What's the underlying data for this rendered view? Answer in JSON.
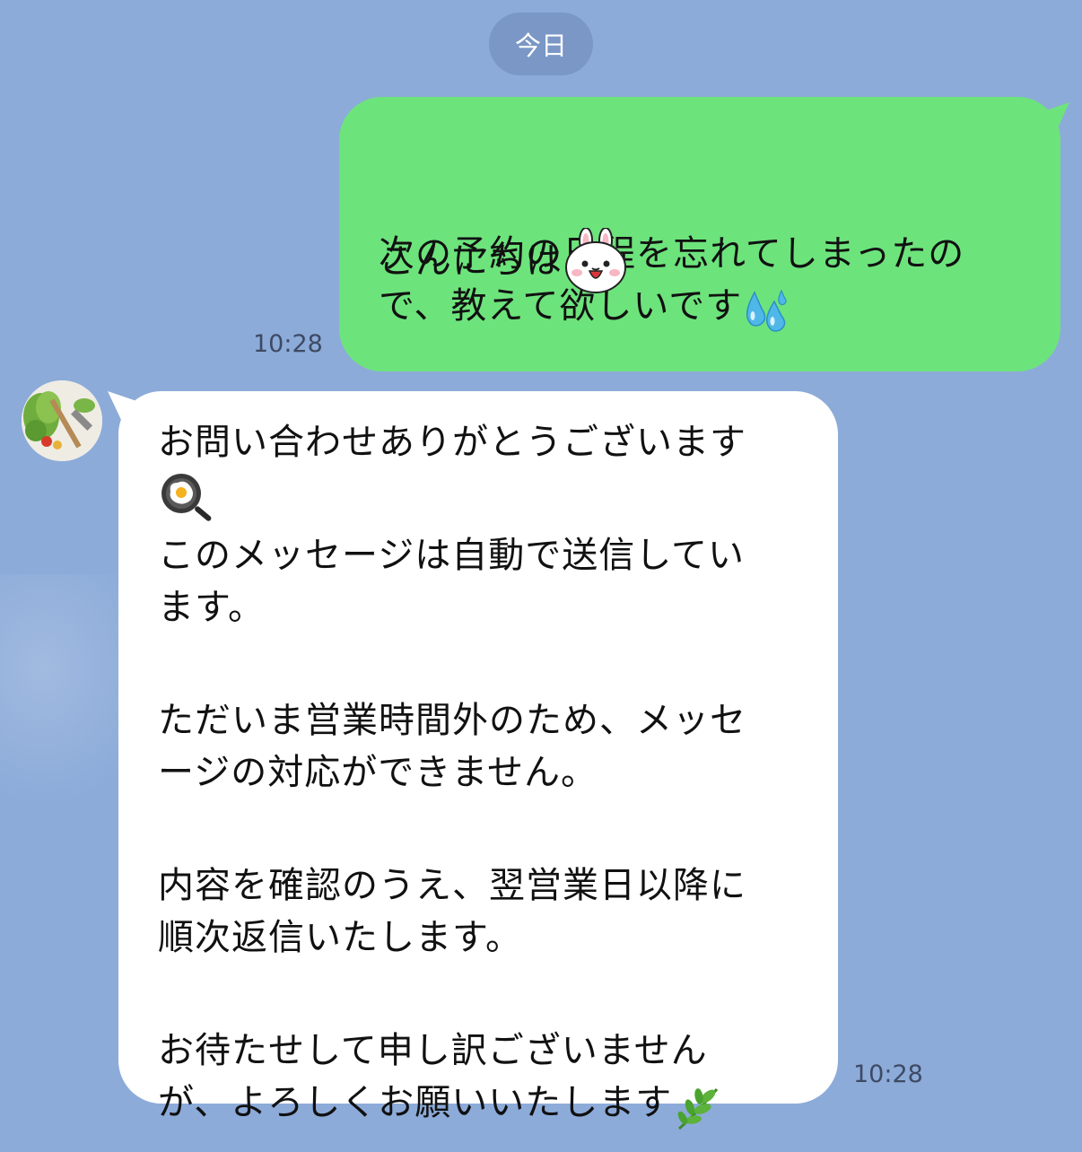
{
  "chat": {
    "date_separator": "今日",
    "messages": [
      {
        "direction": "outgoing",
        "lines": [
          "こんにちは",
          "次の予約の日程を忘れてしまったの",
          "で、教えて欲しいです"
        ],
        "emojis": [
          "bunny-sticker-emoji",
          "sweat-droplets-emoji"
        ],
        "time": "10:28"
      },
      {
        "direction": "incoming",
        "lines": [
          "お問い合わせありがとうございます",
          "このメッセージは自動で送信してい",
          "ます。",
          "ただいま営業時間外のため、メッセ",
          "ージの対応ができません。",
          "内容を確認のうえ、翌営業日以降に",
          "順次返信いたします。",
          "お待たせして申し訳ございません",
          "が、よろしくお願いいたします"
        ],
        "emojis": [
          "frying-pan-egg-emoji",
          "herb-emoji"
        ],
        "time": "10:28"
      }
    ]
  },
  "colors": {
    "background": "#8cabd9",
    "outgoing_bubble": "#6de37c",
    "incoming_bubble": "#ffffff",
    "date_pill": "#7a97c6"
  }
}
